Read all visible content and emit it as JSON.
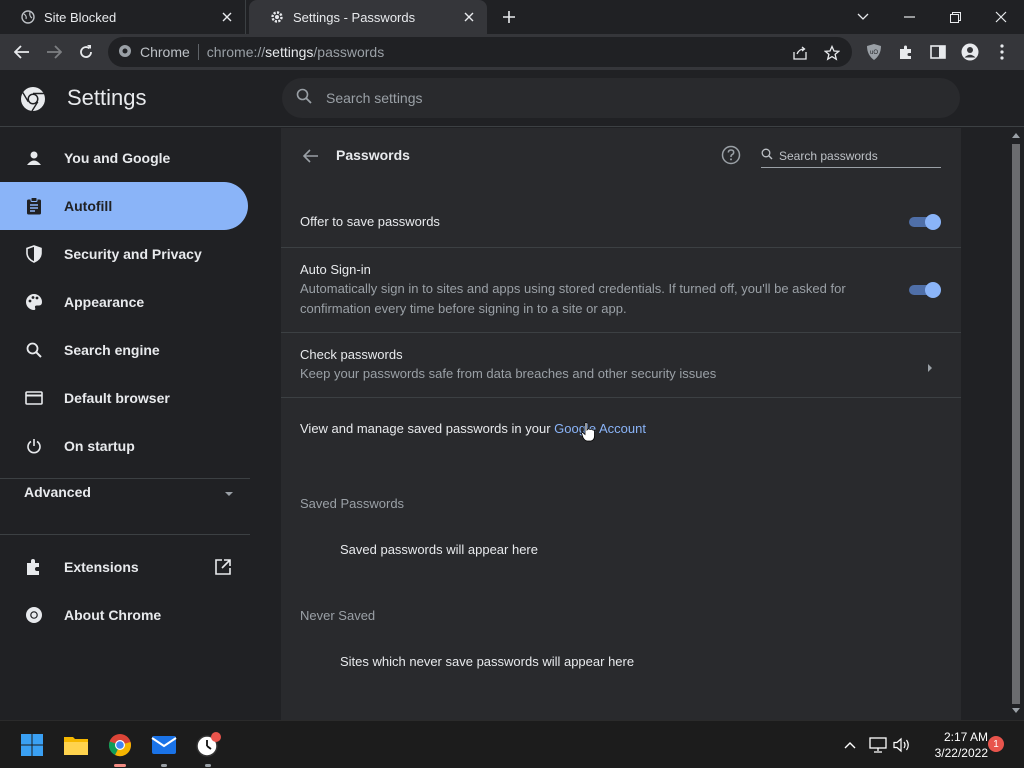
{
  "browser": {
    "tabs": [
      {
        "title": "Site Blocked",
        "favicon": "globe-icon",
        "active": false
      },
      {
        "title": "Settings - Passwords",
        "favicon": "gear-icon",
        "active": true
      }
    ],
    "omnibox": {
      "chip": "Chrome",
      "url_prefix": "chrome://",
      "url_host": "settings",
      "url_path": "/passwords"
    }
  },
  "settings": {
    "title": "Settings",
    "search_placeholder": "Search settings",
    "sidebar": {
      "items": [
        {
          "label": "You and Google",
          "icon": "person-icon"
        },
        {
          "label": "Autofill",
          "icon": "clipboard-icon",
          "selected": true
        },
        {
          "label": "Security and Privacy",
          "icon": "shield-icon"
        },
        {
          "label": "Appearance",
          "icon": "palette-icon"
        },
        {
          "label": "Search engine",
          "icon": "search-icon"
        },
        {
          "label": "Default browser",
          "icon": "browser-window-icon"
        },
        {
          "label": "On startup",
          "icon": "power-icon"
        }
      ],
      "advanced_label": "Advanced",
      "extensions_label": "Extensions",
      "about_label": "About Chrome"
    },
    "passwords": {
      "title": "Passwords",
      "search_placeholder": "Search passwords",
      "offer_to_save": {
        "label": "Offer to save passwords",
        "enabled": true
      },
      "auto_signin": {
        "label": "Auto Sign-in",
        "description": "Automatically sign in to sites and apps using stored credentials. If turned off, you'll be asked for confirmation every time before signing in to a site or app.",
        "enabled": true
      },
      "check_passwords": {
        "label": "Check passwords",
        "description": "Keep your passwords safe from data breaches and other security issues"
      },
      "google_account": {
        "prefix": "View and manage saved passwords in your ",
        "link": "Google Account"
      },
      "saved_header": "Saved Passwords",
      "saved_empty": "Saved passwords will appear here",
      "never_header": "Never Saved",
      "never_empty": "Sites which never save passwords will appear here"
    }
  },
  "taskbar": {
    "time": "2:17 AM",
    "date": "3/22/2022",
    "notification_count": "1"
  },
  "colors": {
    "accent": "#8ab4f8",
    "background": "#202124",
    "card": "#292a2d"
  }
}
